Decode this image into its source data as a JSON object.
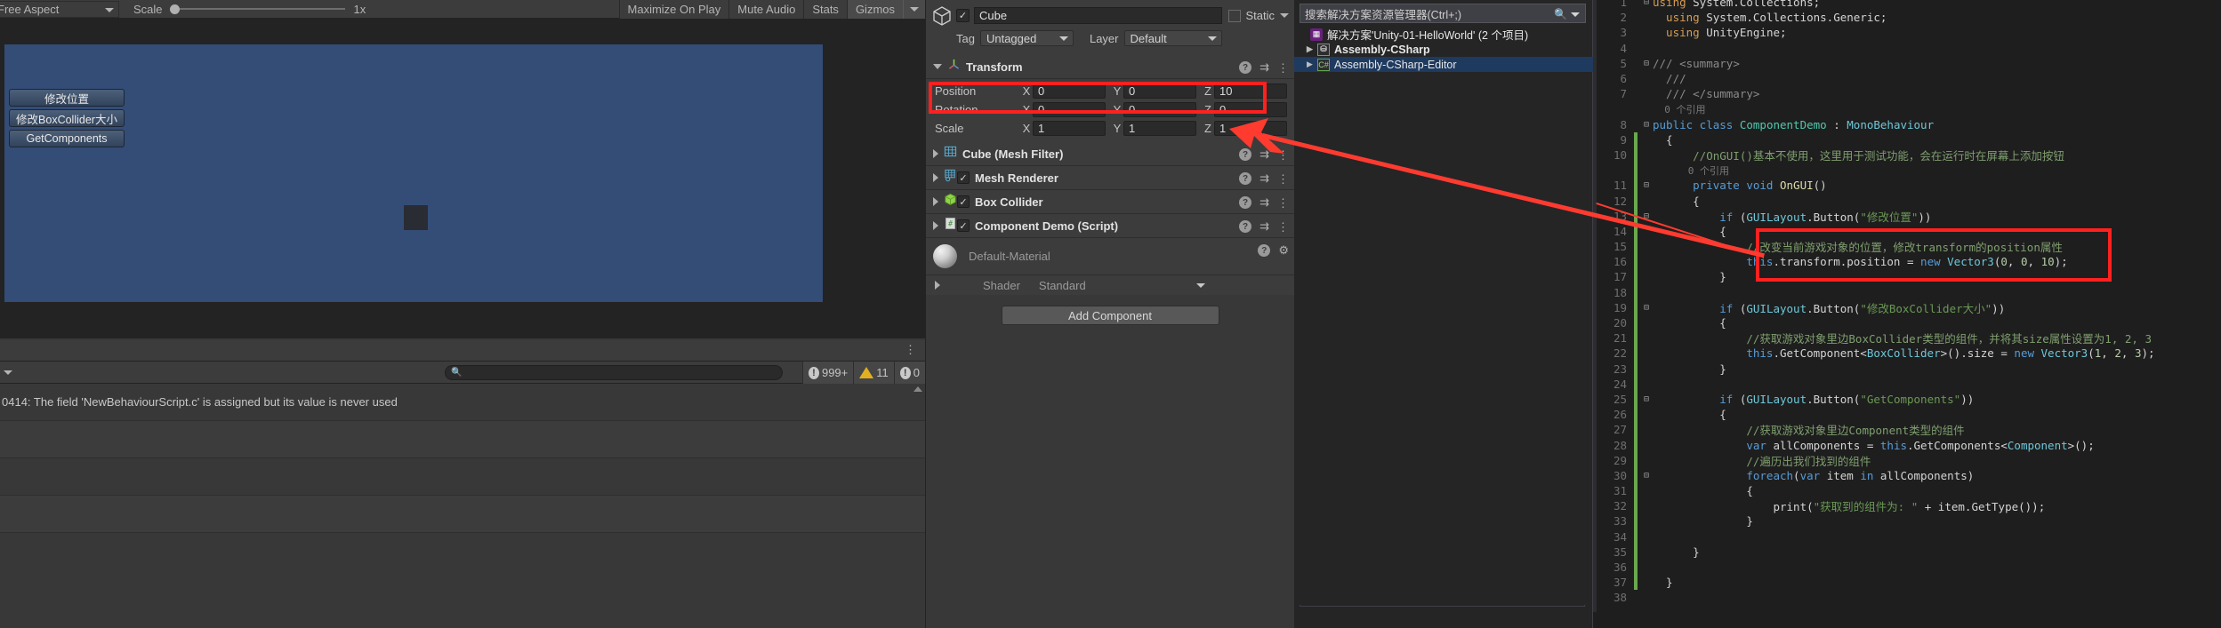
{
  "unity": {
    "game_toolbar": {
      "aspect": "Free Aspect",
      "scale_label": "Scale",
      "scale_value": "1x",
      "buttons": [
        {
          "label": "Maximize On Play",
          "active": false
        },
        {
          "label": "Mute Audio",
          "active": false
        },
        {
          "label": "Stats",
          "active": false
        },
        {
          "label": "Gizmos",
          "active": true
        }
      ]
    },
    "game_view": {
      "gui_buttons": [
        {
          "label": "修改位置"
        },
        {
          "label": "修改BoxCollider大小"
        },
        {
          "label": "GetComponents"
        }
      ]
    },
    "console": {
      "search_placeholder": "",
      "error_count": "999+",
      "warning_count": "11",
      "info_count": "0",
      "messages": [
        {
          "text": "0414: The field 'NewBehaviourScript.c' is assigned but its value is never used"
        },
        {
          "text": ""
        },
        {
          "text": ""
        },
        {
          "text": ""
        }
      ]
    }
  },
  "inspector": {
    "object_name": "Cube",
    "enabled": true,
    "static_label": "Static",
    "tag_label": "Tag",
    "tag_value": "Untagged",
    "layer_label": "Layer",
    "layer_value": "Default",
    "transform": {
      "title": "Transform",
      "rows": [
        {
          "name": "Position",
          "x": "0",
          "y": "0",
          "z": "10"
        },
        {
          "name": "Rotation",
          "x": "0",
          "y": "0",
          "z": "0"
        },
        {
          "name": "Scale",
          "x": "1",
          "y": "1",
          "z": "1"
        }
      ]
    },
    "components": [
      {
        "title": "Cube (Mesh Filter)",
        "has_toggle": false,
        "checked": false,
        "icon": "mesh-filter-icon"
      },
      {
        "title": "Mesh Renderer",
        "has_toggle": true,
        "checked": true,
        "icon": "mesh-renderer-icon"
      },
      {
        "title": "Box Collider",
        "has_toggle": true,
        "checked": true,
        "icon": "box-collider-icon"
      },
      {
        "title": "Component Demo (Script)",
        "has_toggle": true,
        "checked": true,
        "icon": "script-icon"
      }
    ],
    "material": {
      "name": "Default-Material",
      "shader_label": "Shader",
      "shader_value": "Standard"
    },
    "add_component_label": "Add Component"
  },
  "vs": {
    "solution_search_placeholder": "搜索解决方案资源管理器(Ctrl+;)",
    "tree": [
      {
        "label": "解决方案'Unity-01-HelloWorld' (2 个项目)",
        "icon": "solution-icon",
        "indent": 0,
        "expander": false,
        "bold": false,
        "selected": false
      },
      {
        "label": "Assembly-CSharp",
        "icon": "assembly-icon",
        "indent": 1,
        "expander": true,
        "bold": true,
        "selected": false
      },
      {
        "label": "Assembly-CSharp-Editor",
        "icon": "csharp-icon",
        "indent": 1,
        "expander": true,
        "bold": false,
        "selected": true
      }
    ],
    "code": {
      "lines": [
        {
          "n": 1,
          "fold": "-",
          "bar": "",
          "segs": [
            {
              "t": "using ",
              "c": "kw"
            },
            {
              "t": "System.Collections;",
              "c": "pl"
            }
          ]
        },
        {
          "n": 2,
          "fold": "",
          "bar": "",
          "segs": [
            {
              "t": "  using ",
              "c": "kw"
            },
            {
              "t": "System.Collections.Generic;",
              "c": "pl"
            }
          ]
        },
        {
          "n": 3,
          "fold": "",
          "bar": "",
          "segs": [
            {
              "t": "  using ",
              "c": "kw"
            },
            {
              "t": "UnityEngine;",
              "c": "pl"
            }
          ]
        },
        {
          "n": 4,
          "fold": "",
          "bar": "",
          "segs": []
        },
        {
          "n": 5,
          "fold": "-",
          "bar": "",
          "segs": [
            {
              "t": "/// ",
              "c": "cmg"
            },
            {
              "t": "<summary>",
              "c": "cmg"
            }
          ]
        },
        {
          "n": 6,
          "fold": "",
          "bar": "",
          "segs": [
            {
              "t": "  /// ",
              "c": "cmg"
            }
          ]
        },
        {
          "n": 7,
          "fold": "",
          "bar": "",
          "segs": [
            {
              "t": "  /// ",
              "c": "cmg"
            },
            {
              "t": "</summary>",
              "c": "cmg"
            }
          ]
        },
        {
          "n": "",
          "fold": "",
          "bar": "",
          "segs": [
            {
              "t": "  0 个引用",
              "c": "ref"
            }
          ]
        },
        {
          "n": 8,
          "fold": "-",
          "bar": "",
          "segs": [
            {
              "t": "public class ",
              "c": "k"
            },
            {
              "t": "ComponentDemo",
              "c": "ty"
            },
            {
              "t": " : ",
              "c": "pl"
            },
            {
              "t": "MonoBehaviour",
              "c": "cls"
            }
          ]
        },
        {
          "n": 9,
          "fold": "",
          "bar": "g",
          "segs": [
            {
              "t": "  {",
              "c": "pl"
            }
          ]
        },
        {
          "n": 10,
          "fold": "",
          "bar": "g",
          "segs": [
            {
              "t": "      //OnGUI()基本不使用，这里用于测试功能，会在运行时在屏幕上添加按钮",
              "c": "cm"
            }
          ]
        },
        {
          "n": "",
          "fold": "",
          "bar": "g",
          "segs": [
            {
              "t": "      0 个引用",
              "c": "ref"
            }
          ]
        },
        {
          "n": 11,
          "fold": "-",
          "bar": "g",
          "segs": [
            {
              "t": "      private void ",
              "c": "k"
            },
            {
              "t": "OnGUI",
              "c": "mth"
            },
            {
              "t": "()",
              "c": "pl"
            }
          ]
        },
        {
          "n": 12,
          "fold": "",
          "bar": "g",
          "segs": [
            {
              "t": "      {",
              "c": "pl"
            }
          ]
        },
        {
          "n": 13,
          "fold": "-",
          "bar": "g",
          "segs": [
            {
              "t": "          if ",
              "c": "k"
            },
            {
              "t": "(",
              "c": "pl"
            },
            {
              "t": "GUILayout",
              "c": "cls"
            },
            {
              "t": ".Button(",
              "c": "pl"
            },
            {
              "t": "\"修改位置\"",
              "c": "st"
            },
            {
              "t": "))",
              "c": "pl"
            }
          ]
        },
        {
          "n": 14,
          "fold": "",
          "bar": "g",
          "segs": [
            {
              "t": "          {",
              "c": "pl"
            }
          ]
        },
        {
          "n": 15,
          "fold": "",
          "bar": "g",
          "segs": [
            {
              "t": "              //改变当前游戏对象的位置，修改transform的position属性",
              "c": "cm"
            }
          ]
        },
        {
          "n": 16,
          "fold": "",
          "bar": "g",
          "segs": [
            {
              "t": "              this",
              "c": "k"
            },
            {
              "t": ".transform.position = ",
              "c": "pl"
            },
            {
              "t": "new ",
              "c": "k"
            },
            {
              "t": "Vector3",
              "c": "cls"
            },
            {
              "t": "(",
              "c": "pl"
            },
            {
              "t": "0",
              "c": "nm"
            },
            {
              "t": ", ",
              "c": "pl"
            },
            {
              "t": "0",
              "c": "nm"
            },
            {
              "t": ", ",
              "c": "pl"
            },
            {
              "t": "10",
              "c": "nm"
            },
            {
              "t": ");",
              "c": "pl"
            }
          ]
        },
        {
          "n": 17,
          "fold": "",
          "bar": "g",
          "segs": [
            {
              "t": "          }",
              "c": "pl"
            }
          ]
        },
        {
          "n": 18,
          "fold": "",
          "bar": "g",
          "segs": []
        },
        {
          "n": 19,
          "fold": "-",
          "bar": "g",
          "segs": [
            {
              "t": "          if ",
              "c": "k"
            },
            {
              "t": "(",
              "c": "pl"
            },
            {
              "t": "GUILayout",
              "c": "cls"
            },
            {
              "t": ".Button(",
              "c": "pl"
            },
            {
              "t": "\"修改BoxCollider大小\"",
              "c": "st"
            },
            {
              "t": "))",
              "c": "pl"
            }
          ]
        },
        {
          "n": 20,
          "fold": "",
          "bar": "g",
          "segs": [
            {
              "t": "          {",
              "c": "pl"
            }
          ]
        },
        {
          "n": 21,
          "fold": "",
          "bar": "g",
          "segs": [
            {
              "t": "              //获取游戏对象里边BoxCollider类型的组件，并将其size属性设置为1, 2, 3",
              "c": "cm"
            }
          ]
        },
        {
          "n": 22,
          "fold": "",
          "bar": "g",
          "segs": [
            {
              "t": "              this",
              "c": "k"
            },
            {
              "t": ".GetComponent<",
              "c": "pl"
            },
            {
              "t": "BoxCollider",
              "c": "cls"
            },
            {
              "t": ">().size = ",
              "c": "pl"
            },
            {
              "t": "new ",
              "c": "k"
            },
            {
              "t": "Vector3",
              "c": "cls"
            },
            {
              "t": "(",
              "c": "pl"
            },
            {
              "t": "1",
              "c": "nm"
            },
            {
              "t": ", ",
              "c": "pl"
            },
            {
              "t": "2",
              "c": "nm"
            },
            {
              "t": ", ",
              "c": "pl"
            },
            {
              "t": "3",
              "c": "nm"
            },
            {
              "t": ");",
              "c": "pl"
            }
          ]
        },
        {
          "n": 23,
          "fold": "",
          "bar": "g",
          "segs": [
            {
              "t": "          }",
              "c": "pl"
            }
          ]
        },
        {
          "n": 24,
          "fold": "",
          "bar": "g",
          "segs": []
        },
        {
          "n": 25,
          "fold": "-",
          "bar": "g",
          "segs": [
            {
              "t": "          if ",
              "c": "k"
            },
            {
              "t": "(",
              "c": "pl"
            },
            {
              "t": "GUILayout",
              "c": "cls"
            },
            {
              "t": ".Button(",
              "c": "pl"
            },
            {
              "t": "\"GetComponents\"",
              "c": "st"
            },
            {
              "t": "))",
              "c": "pl"
            }
          ]
        },
        {
          "n": 26,
          "fold": "",
          "bar": "g",
          "segs": [
            {
              "t": "          {",
              "c": "pl"
            }
          ]
        },
        {
          "n": 27,
          "fold": "",
          "bar": "g",
          "segs": [
            {
              "t": "              //获取游戏对象里边Component类型的组件",
              "c": "cm"
            }
          ]
        },
        {
          "n": 28,
          "fold": "",
          "bar": "g",
          "segs": [
            {
              "t": "              var ",
              "c": "k"
            },
            {
              "t": "allComponents = ",
              "c": "pl"
            },
            {
              "t": "this",
              "c": "k"
            },
            {
              "t": ".GetComponents<",
              "c": "pl"
            },
            {
              "t": "Component",
              "c": "cls"
            },
            {
              "t": ">();",
              "c": "pl"
            }
          ]
        },
        {
          "n": 29,
          "fold": "",
          "bar": "g",
          "segs": [
            {
              "t": "              //遍历出我们找到的组件",
              "c": "cm"
            }
          ]
        },
        {
          "n": 30,
          "fold": "-",
          "bar": "g",
          "segs": [
            {
              "t": "              foreach",
              "c": "k"
            },
            {
              "t": "(",
              "c": "pl"
            },
            {
              "t": "var ",
              "c": "k"
            },
            {
              "t": "item ",
              "c": "pl"
            },
            {
              "t": "in ",
              "c": "k"
            },
            {
              "t": "allComponents)",
              "c": "pl"
            }
          ]
        },
        {
          "n": 31,
          "fold": "",
          "bar": "g",
          "segs": [
            {
              "t": "              {",
              "c": "pl"
            }
          ]
        },
        {
          "n": 32,
          "fold": "",
          "bar": "g",
          "segs": [
            {
              "t": "                  print(",
              "c": "pl"
            },
            {
              "t": "\"获取到的组件为: \"",
              "c": "st"
            },
            {
              "t": " + item.GetType());",
              "c": "pl"
            }
          ]
        },
        {
          "n": 33,
          "fold": "",
          "bar": "g",
          "segs": [
            {
              "t": "              }",
              "c": "pl"
            }
          ]
        },
        {
          "n": 34,
          "fold": "",
          "bar": "g",
          "segs": []
        },
        {
          "n": 35,
          "fold": "",
          "bar": "g",
          "segs": [
            {
              "t": "      }",
              "c": "pl"
            }
          ]
        },
        {
          "n": 36,
          "fold": "",
          "bar": "g",
          "segs": []
        },
        {
          "n": 37,
          "fold": "",
          "bar": "g",
          "segs": [
            {
              "t": "  }",
              "c": "pl"
            }
          ]
        },
        {
          "n": 38,
          "fold": "",
          "bar": "",
          "segs": []
        }
      ]
    }
  },
  "annotations": {
    "accent_color": "#ff2020",
    "arrow_color": "#ff3b30"
  }
}
